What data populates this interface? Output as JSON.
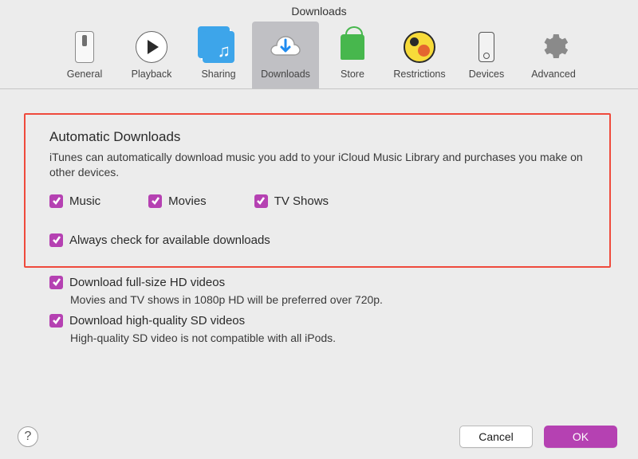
{
  "window_title": "Downloads",
  "toolbar": {
    "tabs": [
      {
        "label": "General"
      },
      {
        "label": "Playback"
      },
      {
        "label": "Sharing"
      },
      {
        "label": "Downloads"
      },
      {
        "label": "Store"
      },
      {
        "label": "Restrictions"
      },
      {
        "label": "Devices"
      },
      {
        "label": "Advanced"
      }
    ],
    "selected_index": 3
  },
  "section": {
    "title": "Automatic Downloads",
    "subtitle": "iTunes can automatically download music you add to your iCloud Music Library and purchases you make on other devices.",
    "checks": {
      "music": "Music",
      "movies": "Movies",
      "tvshows": "TV Shows"
    },
    "always_check": "Always check for available downloads"
  },
  "options": {
    "hd": {
      "label": "Download full-size HD videos",
      "sub": "Movies and TV shows in 1080p HD will be preferred over 720p."
    },
    "sd": {
      "label": "Download high-quality SD videos",
      "sub": "High-quality SD video is not compatible with all iPods."
    }
  },
  "buttons": {
    "help": "?",
    "cancel": "Cancel",
    "ok": "OK"
  }
}
